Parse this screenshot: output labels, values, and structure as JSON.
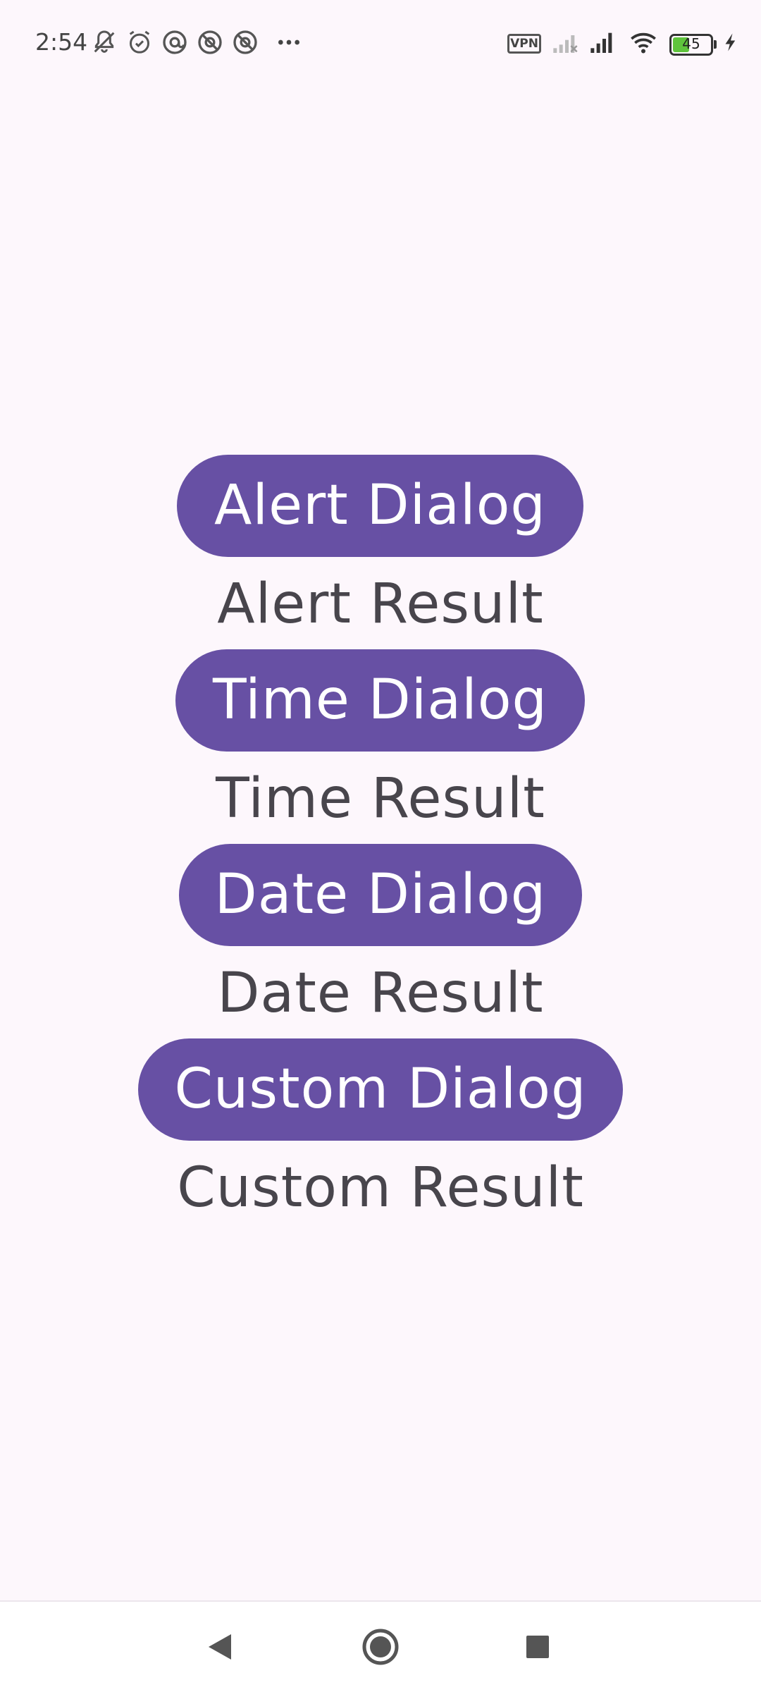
{
  "status_bar": {
    "time": "2:54",
    "vpn_label": "VPN",
    "battery_level": "45",
    "battery_fraction": 0.45,
    "left_icons": [
      "bell-muted-icon",
      "alarm-icon",
      "at-icon",
      "blocked-at-icon",
      "blocked-at-icon",
      "more-dots-icon"
    ],
    "right_icons": [
      "vpn-icon",
      "signal-weak-icon",
      "signal-full-icon",
      "wifi-icon",
      "battery-icon",
      "charging-icon"
    ]
  },
  "buttons": {
    "alert_dialog": "Alert Dialog",
    "time_dialog": "Time Dialog",
    "date_dialog": "Date Dialog",
    "custom_dialog": "Custom Dialog"
  },
  "results": {
    "alert_result": "Alert Result",
    "time_result": "Time Result",
    "date_result": "Date Result",
    "custom_result": "Custom Result"
  },
  "colors": {
    "primary": "#6750a4",
    "background": "#fdf7fc",
    "result_text": "#48454c"
  },
  "nav_bar": {
    "icons": [
      "back-triangle-icon",
      "home-circle-icon",
      "recents-square-icon"
    ]
  }
}
